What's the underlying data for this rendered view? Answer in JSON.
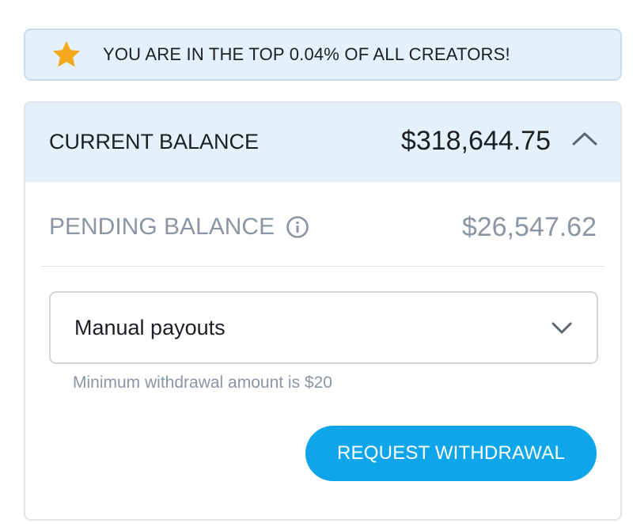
{
  "banner": {
    "icon": "star-icon",
    "icon_color": "#f6a81c",
    "text": "YOU ARE IN THE TOP 0.04% OF ALL CREATORS!"
  },
  "balance": {
    "current_label": "CURRENT BALANCE",
    "current_amount": "$318,644.75",
    "collapse_icon": "chevron-up-icon",
    "pending_label": "PENDING BALANCE",
    "pending_info_icon": "info-icon",
    "pending_amount": "$26,547.62"
  },
  "payout": {
    "selected": "Manual payouts",
    "dropdown_icon": "chevron-down-icon",
    "hint": "Minimum withdrawal amount is $20"
  },
  "actions": {
    "request_label": "REQUEST WITHDRAWAL"
  },
  "colors": {
    "accent": "#0ea5ea",
    "header_bg": "#e4f1fb",
    "muted_text": "#8a96a3"
  }
}
